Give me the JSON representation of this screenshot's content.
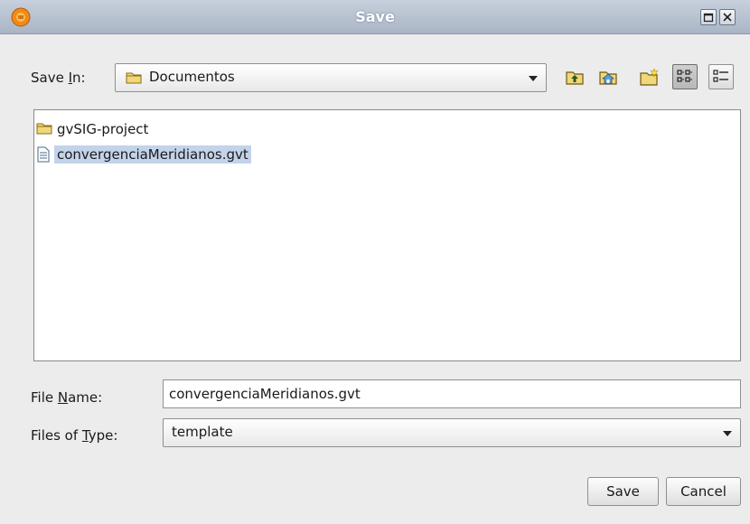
{
  "window": {
    "title": "Save",
    "controls": [
      "maximize-icon",
      "close-icon"
    ]
  },
  "toolbar": {
    "save_in_label_pre": "Save ",
    "save_in_label_mnemonic": "I",
    "save_in_label_post": "n:",
    "current_folder": "Documentos",
    "buttons": [
      "up-one-level-icon",
      "home-icon",
      "new-folder-icon",
      "list-view-icon",
      "details-view-icon"
    ],
    "active_view": "list-view-icon"
  },
  "files": [
    {
      "name": "gvSIG-project",
      "type": "folder",
      "selected": false
    },
    {
      "name": "convergenciaMeridianos.gvt",
      "type": "file",
      "selected": true
    }
  ],
  "form": {
    "file_name_label_pre": "File ",
    "file_name_label_mnemonic": "N",
    "file_name_label_post": "ame:",
    "file_name_value": "convergenciaMeridianos.gvt",
    "file_type_label_pre": "Files of ",
    "file_type_label_mnemonic": "T",
    "file_type_label_post": "ype:",
    "file_type_value": "template"
  },
  "actions": {
    "save_label": "Save",
    "cancel_label": "Cancel"
  },
  "colors": {
    "selection": "#c2d3ea",
    "folder": "#f2d77a"
  }
}
